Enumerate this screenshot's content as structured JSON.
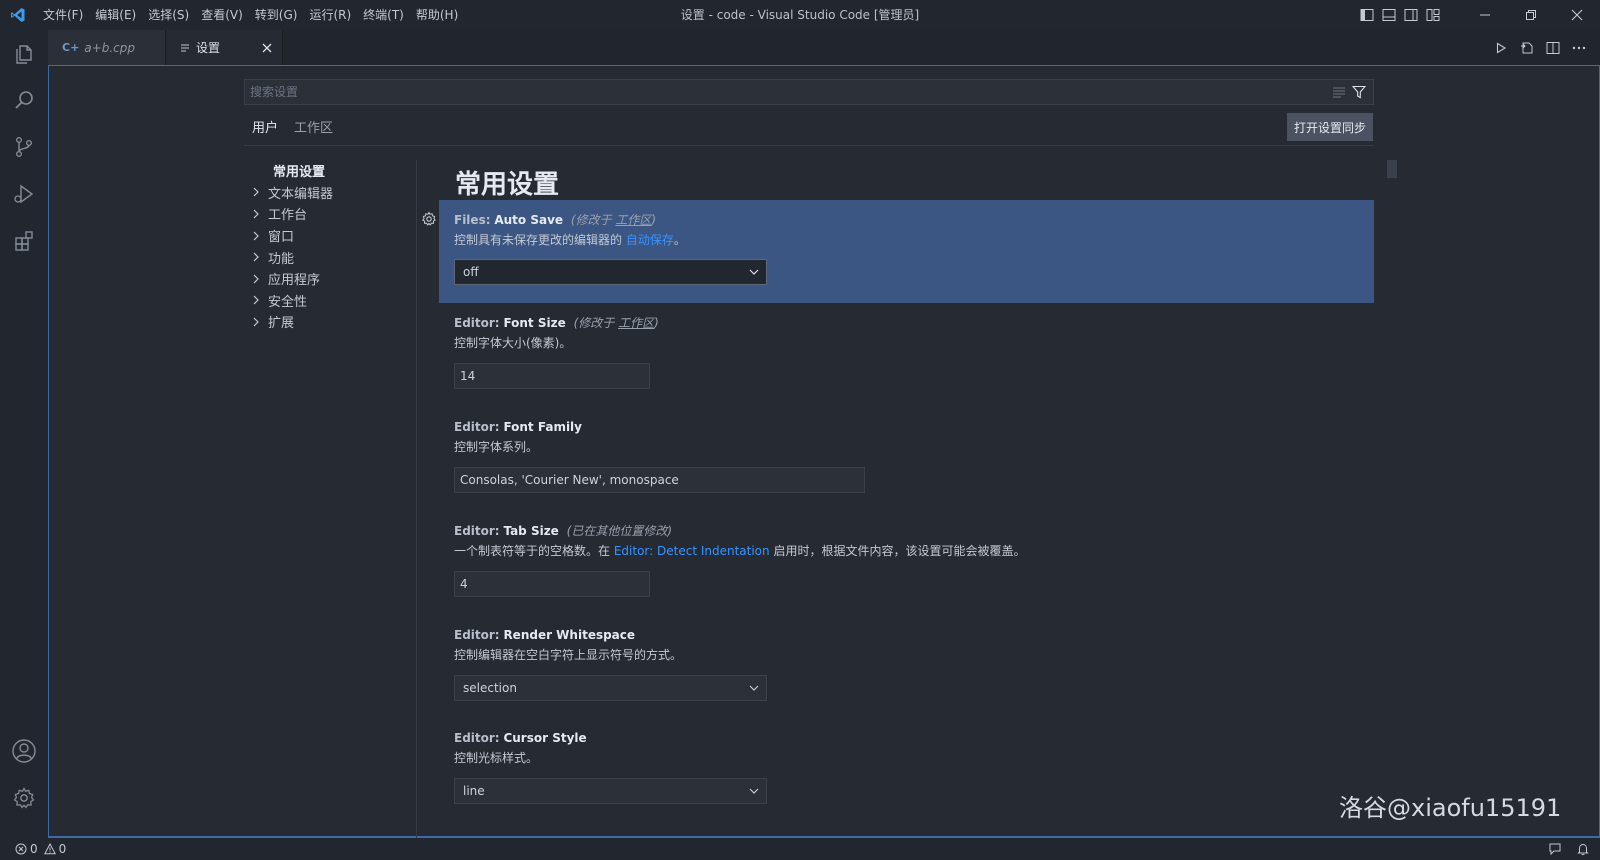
{
  "window": {
    "title": "设置 - code - Visual Studio Code [管理员]"
  },
  "menu": [
    "文件(F)",
    "编辑(E)",
    "选择(S)",
    "查看(V)",
    "转到(G)",
    "运行(R)",
    "终端(T)",
    "帮助(H)"
  ],
  "tabs": [
    {
      "label": "a+b.cpp",
      "icon": "cpp-file-icon",
      "active": false
    },
    {
      "label": "设置",
      "icon": "settings-file-icon",
      "active": true
    }
  ],
  "search": {
    "placeholder": "搜索设置",
    "value": ""
  },
  "scopes": {
    "user": "用户",
    "workspace": "工作区",
    "active": "用户"
  },
  "sync_button": "打开设置同步",
  "toc": {
    "active": "常用设置",
    "items": [
      "文本编辑器",
      "工作台",
      "窗口",
      "功能",
      "应用程序",
      "安全性",
      "扩展"
    ]
  },
  "section_title": "常用设置",
  "settings": [
    {
      "category": "Files:",
      "key": "Auto Save",
      "modified_prefix": "(修改于",
      "modified_link": "工作区",
      "modified_suffix": ")",
      "desc_before": "控制具有未保存更改的编辑器的",
      "desc_link": "自动保存",
      "desc_after": "。",
      "control": "select",
      "value": "off",
      "focused": true
    },
    {
      "category": "Editor:",
      "key": "Font Size",
      "modified_prefix": "(修改于",
      "modified_link": "工作区",
      "modified_suffix": ")",
      "desc": "控制字体大小(像素)。",
      "control": "input",
      "value": "14"
    },
    {
      "category": "Editor:",
      "key": "Font Family",
      "desc": "控制字体系列。",
      "control": "input",
      "value": "Consolas, 'Courier New', monospace"
    },
    {
      "category": "Editor:",
      "key": "Tab Size",
      "modified_note": "(已在其他位置修改)",
      "desc_before": "一个制表符等于的空格数。在",
      "desc_link": "Editor: Detect Indentation",
      "desc_after": "启用时，根据文件内容，该设置可能会被覆盖。",
      "control": "input",
      "value": "4"
    },
    {
      "category": "Editor:",
      "key": "Render Whitespace",
      "desc": "控制编辑器在空白字符上显示符号的方式。",
      "control": "select",
      "value": "selection"
    },
    {
      "category": "Editor:",
      "key": "Cursor Style",
      "desc": "控制光标样式。",
      "control": "select",
      "value": "line"
    }
  ],
  "status": {
    "errors": "0",
    "warnings": "0"
  },
  "watermark": "洛谷@xiaofu15191",
  "colors": {
    "accent": "#3794ff",
    "focused_row": "#3c5683",
    "editor_border": "#3f6aa8"
  }
}
